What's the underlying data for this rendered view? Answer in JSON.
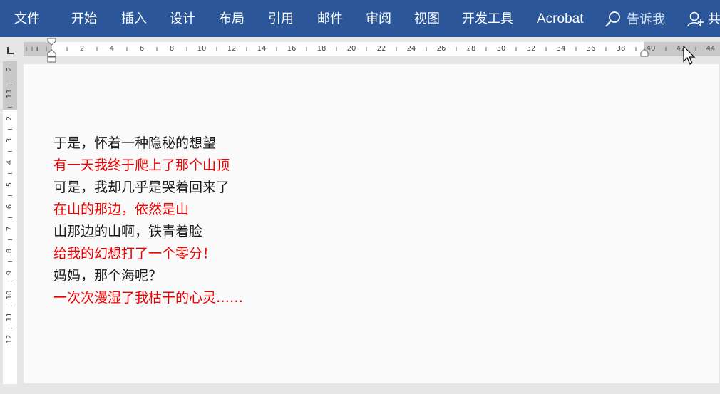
{
  "ribbon": {
    "background": "#2b579a",
    "tabs": [
      {
        "label": "文件"
      },
      {
        "label": "开始"
      },
      {
        "label": "插入"
      },
      {
        "label": "设计"
      },
      {
        "label": "布局"
      },
      {
        "label": "引用"
      },
      {
        "label": "邮件"
      },
      {
        "label": "审阅"
      },
      {
        "label": "视图"
      },
      {
        "label": "开发工具"
      },
      {
        "label": "Acrobat"
      }
    ],
    "tell_me": {
      "label": "告诉我",
      "icon": "search-icon"
    },
    "share": {
      "label": "共",
      "icon": "user-icon"
    }
  },
  "ruler": {
    "horizontal_numbers": [
      "2",
      "4",
      "6",
      "8",
      "10",
      "12",
      "14",
      "16",
      "18",
      "20",
      "22",
      "24",
      "26",
      "28",
      "30",
      "32",
      "34",
      "36",
      "38",
      "40",
      "42",
      "44"
    ],
    "vertical_numbers_top": [
      "2",
      "1"
    ],
    "vertical_numbers": [
      "1",
      "2",
      "3",
      "4",
      "5",
      "6",
      "7",
      "8",
      "9",
      "10",
      "11",
      "12"
    ]
  },
  "document": {
    "lines": [
      {
        "text": "于是，怀着一种隐秘的想望",
        "color": "#1a1a1a"
      },
      {
        "text": "有一天我终于爬上了那个山顶",
        "color": "#ee0000"
      },
      {
        "text": "可是，我却几乎是哭着回来了",
        "color": "#1a1a1a"
      },
      {
        "text": "在山的那边，依然是山",
        "color": "#ee0000"
      },
      {
        "text": "山那边的山啊，铁青着脸",
        "color": "#1a1a1a"
      },
      {
        "text": "给我的幻想打了一个零分！",
        "color": "#ee0000"
      },
      {
        "text": "妈妈，那个海呢？",
        "color": "#1a1a1a"
      },
      {
        "text": "一次次漫湿了我枯干的心灵……",
        "color": "#ee0000"
      }
    ]
  }
}
